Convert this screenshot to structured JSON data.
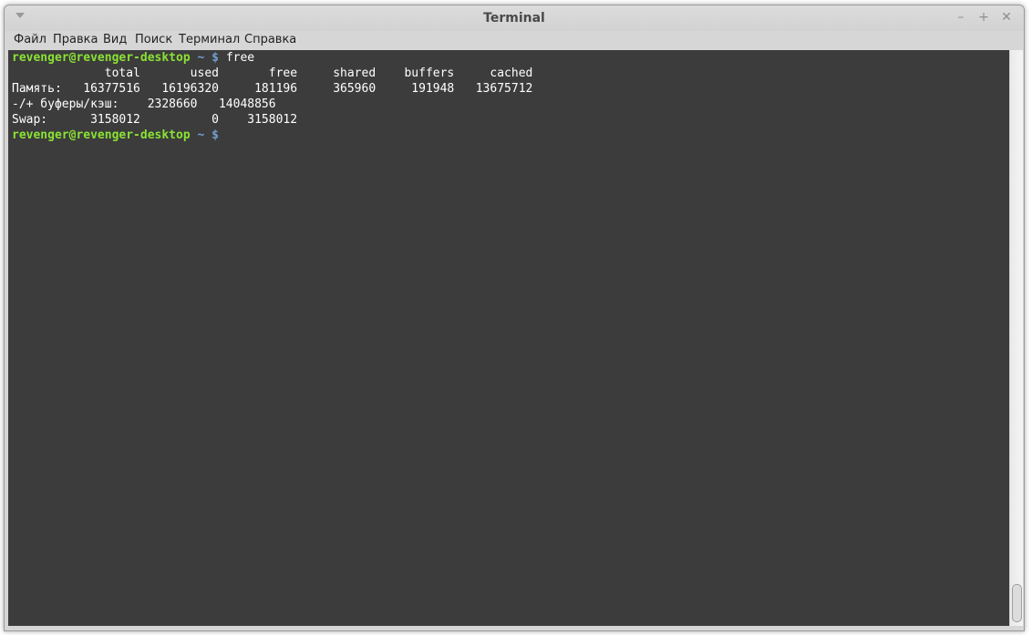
{
  "window": {
    "title": "Terminal",
    "controls": {
      "minimize": "–",
      "maximize": "+",
      "close": "✕"
    }
  },
  "menubar": {
    "items": [
      "Файл",
      "Правка",
      "Вид",
      "Поиск",
      "Терминал",
      "Справка"
    ]
  },
  "terminal": {
    "prompt": {
      "user_host": "revenger@revenger-desktop",
      "path": "~ $"
    },
    "command": "free",
    "output": [
      "             total       used       free     shared    buffers     cached",
      "Память:   16377516   16196320     181196     365960     191948   13675712",
      "-/+ буферы/кэш:    2328660   14048856",
      "Swap:      3158012          0    3158012"
    ],
    "colors": {
      "user_host": "#8ae234",
      "path": "#729fcf",
      "background": "#3c3c3c",
      "text": "#ffffff"
    }
  }
}
